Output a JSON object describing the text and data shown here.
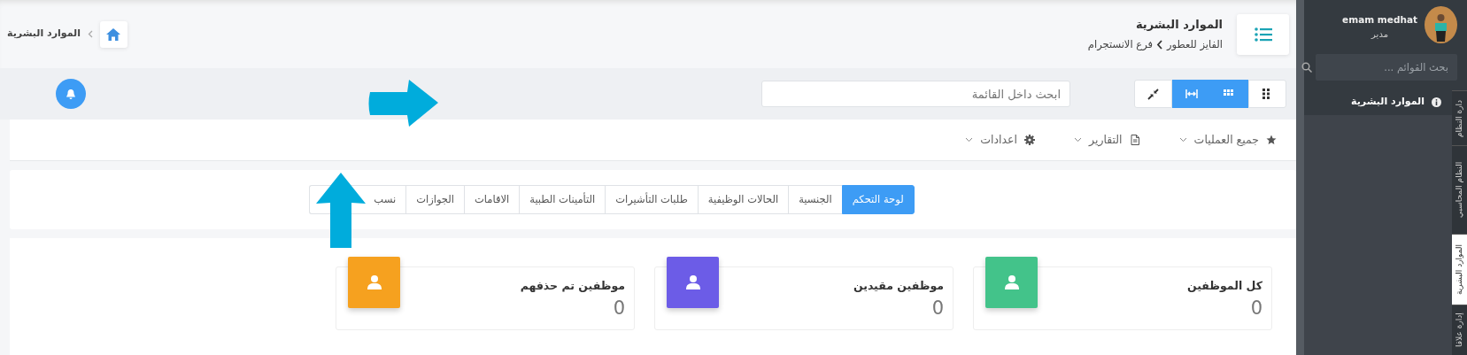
{
  "header": {
    "title": "الموارد البشرية",
    "breadcrumb": [
      "الفايز للعطور",
      "فرع الانستجرام"
    ],
    "home_crumb": "الموارد البشرية"
  },
  "toolbar": {
    "view_buttons": [
      {
        "kind": "grid4",
        "selected": false
      },
      {
        "kind": "grid9",
        "selected": true
      },
      {
        "kind": "expand",
        "selected": true
      },
      {
        "kind": "compress",
        "selected": false
      }
    ],
    "search": {
      "placeholder": "ابحث داخل القائمة"
    }
  },
  "menu": [
    {
      "kind": "star",
      "label": "جميع العمليات"
    },
    {
      "kind": "doc",
      "label": "التقارير"
    },
    {
      "kind": "gear",
      "label": "اعدادات"
    }
  ],
  "tabs": [
    {
      "label": "لوحة التحكم",
      "selected": true
    },
    {
      "label": "الجنسية",
      "selected": false
    },
    {
      "label": "الحالات الوظيفية",
      "selected": false
    },
    {
      "label": "طلبات التأشيرات",
      "selected": false
    },
    {
      "label": "التأمينات الطبية",
      "selected": false
    },
    {
      "label": "الاقامات",
      "selected": false
    },
    {
      "label": "الجوازات",
      "selected": false
    },
    {
      "label": "نسب",
      "selected": false
    }
  ],
  "stats": [
    {
      "label": "كل الموظفين",
      "value": "0",
      "color": "#43c38a"
    },
    {
      "label": "موظفين مقيدين",
      "value": "0",
      "color": "#6c5ce7"
    },
    {
      "label": "موظفين تم حذفهم",
      "value": "0",
      "color": "#f6a11f"
    }
  ],
  "sidebar": {
    "user": {
      "name": "emam medhat",
      "role": "مدير"
    },
    "search": {
      "placeholder": "بحث القوائم ..."
    },
    "items": [
      {
        "label": "الموارد البشرية"
      }
    ],
    "vertical_tabs": [
      {
        "label": "دارة النظام",
        "selected": false
      },
      {
        "label": "النظام المحاسبي",
        "selected": false
      },
      {
        "label": "الموارد البشرية",
        "selected": true
      },
      {
        "label": "إدارة علاقا",
        "selected": false
      }
    ]
  }
}
